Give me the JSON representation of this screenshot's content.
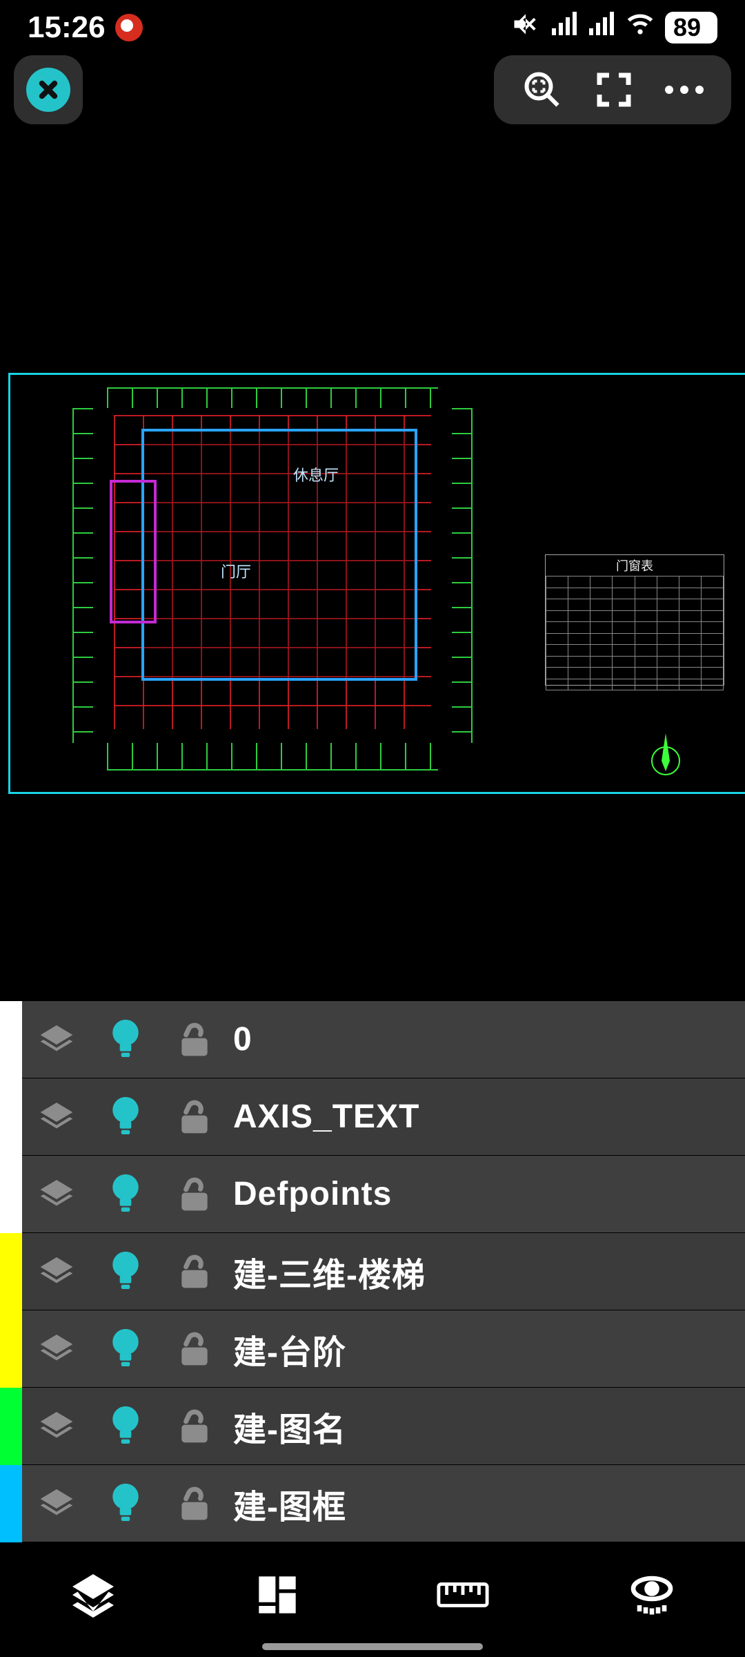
{
  "statusbar": {
    "time": "15:26",
    "battery": "89"
  },
  "canvas": {
    "rooms": {
      "lounge": "休息厅",
      "lobby": "门厅"
    },
    "schedule_title": "门窗表"
  },
  "layers": [
    {
      "color": "#ffffff",
      "name": "0"
    },
    {
      "color": "#ffffff",
      "name": "AXIS_TEXT"
    },
    {
      "color": "#ffffff",
      "name": "Defpoints"
    },
    {
      "color": "#ffff00",
      "name": "建-三维-楼梯"
    },
    {
      "color": "#ffff00",
      "name": "建-台阶"
    },
    {
      "color": "#00ff33",
      "name": "建-图名"
    },
    {
      "color": "#00bfff",
      "name": "建-图框"
    }
  ]
}
